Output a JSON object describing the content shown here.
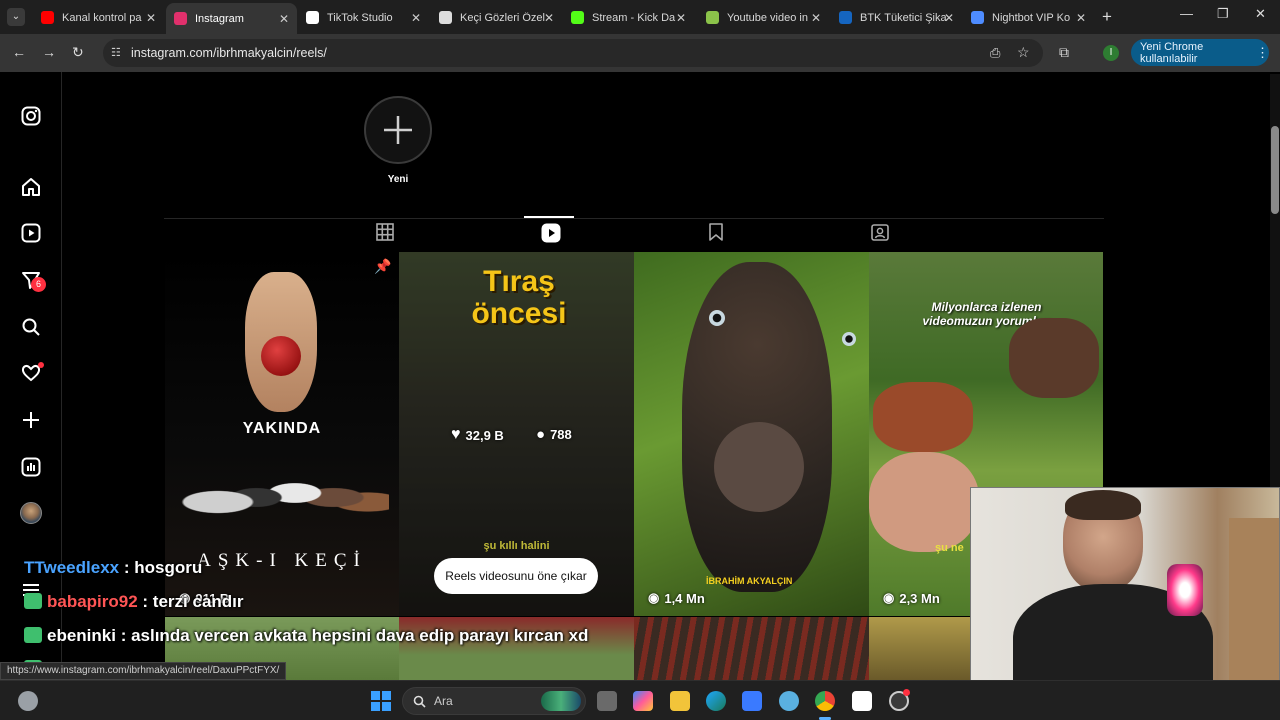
{
  "browser": {
    "tabs": [
      {
        "title": "Kanal kontrol pa",
        "favicon": "youtube-icon",
        "color": "#ff0000"
      },
      {
        "title": "Instagram",
        "favicon": "instagram-icon",
        "color": "#e1306c"
      },
      {
        "title": "TikTok Studio",
        "favicon": "tiktok-icon",
        "color": "#ffffff"
      },
      {
        "title": "Keçi Gözleri Özel",
        "favicon": "chatgpt-icon",
        "color": "#dddddd"
      },
      {
        "title": "Stream - Kick Da",
        "favicon": "kick-icon",
        "color": "#53fc18"
      },
      {
        "title": "Youtube video in",
        "favicon": "download-icon",
        "color": "#8bc34a"
      },
      {
        "title": "BTK Tüketici Şika",
        "favicon": "btk-icon",
        "color": "#1565c0"
      },
      {
        "title": "Nightbot VIP Ko",
        "favicon": "gemini-icon",
        "color": "#4e8cff"
      }
    ],
    "active_tab": 1,
    "url": "instagram.com/ibrhmakyalcin/reels/",
    "chrome_button": "Yeni Chrome kullanılabilir",
    "profile_initial": "I"
  },
  "sidebar": {
    "notification_count": "6"
  },
  "profile": {
    "new_story_label": "Yeni"
  },
  "reels": [
    {
      "caption": "YAKINDA",
      "subtitle": "AŞK-I KEÇİ",
      "views": "911 B",
      "pinned": true
    },
    {
      "caption": "Tıraş öncesi",
      "likes": "32,9 B",
      "comments": "788",
      "tooltip": "Reels videosunu öne çıkar",
      "bottom_text": "şu kıllı halini"
    },
    {
      "caption": "İBRAHİM AKYALÇIN",
      "views": "1,4 Mn"
    },
    {
      "caption": "Milyonlarca izlenen videomuzun yorumları",
      "views": "2,3 Mn",
      "bottom_text": "şu ne"
    }
  ],
  "chat": [
    {
      "user": "TTweedlexx",
      "message": ": hosgoru",
      "color": "#4aa3ff"
    },
    {
      "user": "babapiro92",
      "message": ": terzi candır",
      "color": "#ff5555"
    },
    {
      "user": "ebeninki",
      "message": ": aslında vercen avkata hepsini dava edip parayı kırcan xd",
      "color": "#ffffff"
    },
    {
      "user": "ebeninki",
      "message": ":",
      "color": "#ffffff"
    }
  ],
  "status_url": "https://www.instagram.com/ibrhmakyalcin/reel/DaxuPPctFYX/",
  "taskbar": {
    "search_placeholder": "Ara"
  }
}
